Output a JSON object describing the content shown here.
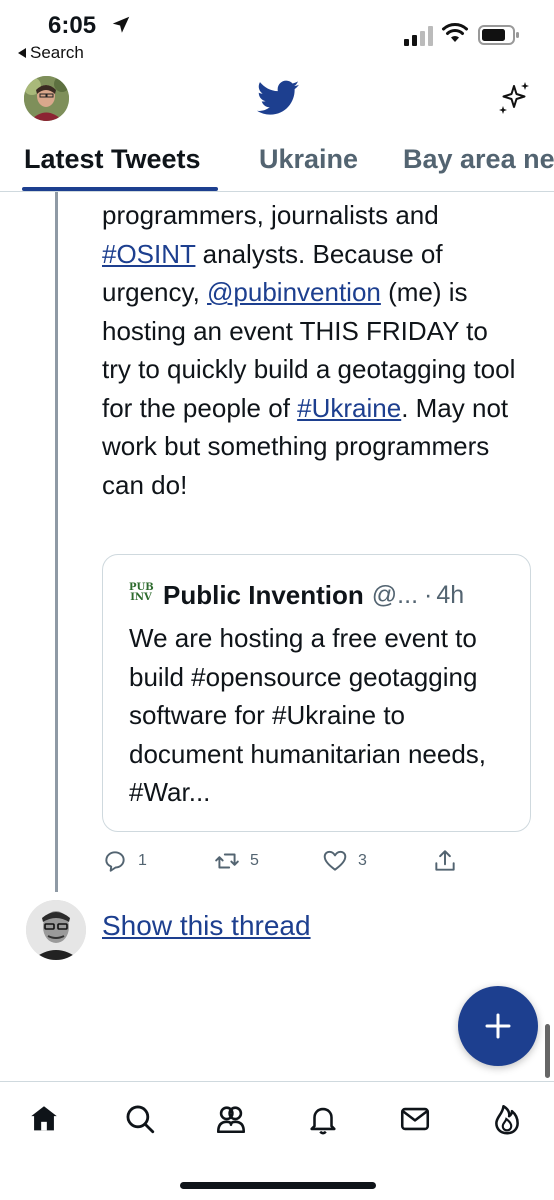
{
  "status_bar": {
    "time": "6:05",
    "back_label": "Search"
  },
  "header": {
    "logo_icon": "twitter-bird-icon",
    "right_icon": "sparkle-icon",
    "accent_color": "#1d3f8f"
  },
  "tabs": [
    {
      "label": "Latest Tweets",
      "active": true
    },
    {
      "label": "Ukraine",
      "active": false
    },
    {
      "label": "Bay area news",
      "active": false
    }
  ],
  "tweet": {
    "line1_text": "programmers, journalists and",
    "hashtag_osint": "#OSINT",
    "line2_rest": " analysts. Because of urgency, ",
    "mention": "@pubinvention",
    "line3_rest": " (me) is hosting an event THIS FRIDAY to try to quickly build a geotagging tool for the people of ",
    "hashtag_ukraine": "#Ukraine",
    "line4_rest": ". May not work but something programmers can do!"
  },
  "quote": {
    "logo_text": "PUB INV",
    "name": "Public Invention",
    "handle": "@...",
    "separator": "·",
    "time": "4h",
    "text": "We are hosting a free event to build #opensource geotagging software for #Ukraine to document humanitarian needs, #War..."
  },
  "actions": {
    "replies": "1",
    "retweets": "5",
    "likes": "3"
  },
  "thread": {
    "show_label": "Show this thread"
  },
  "bottom_nav": [
    "home-icon",
    "search-icon",
    "spaces-icon",
    "notifications-icon",
    "messages-icon",
    "trending-icon"
  ]
}
